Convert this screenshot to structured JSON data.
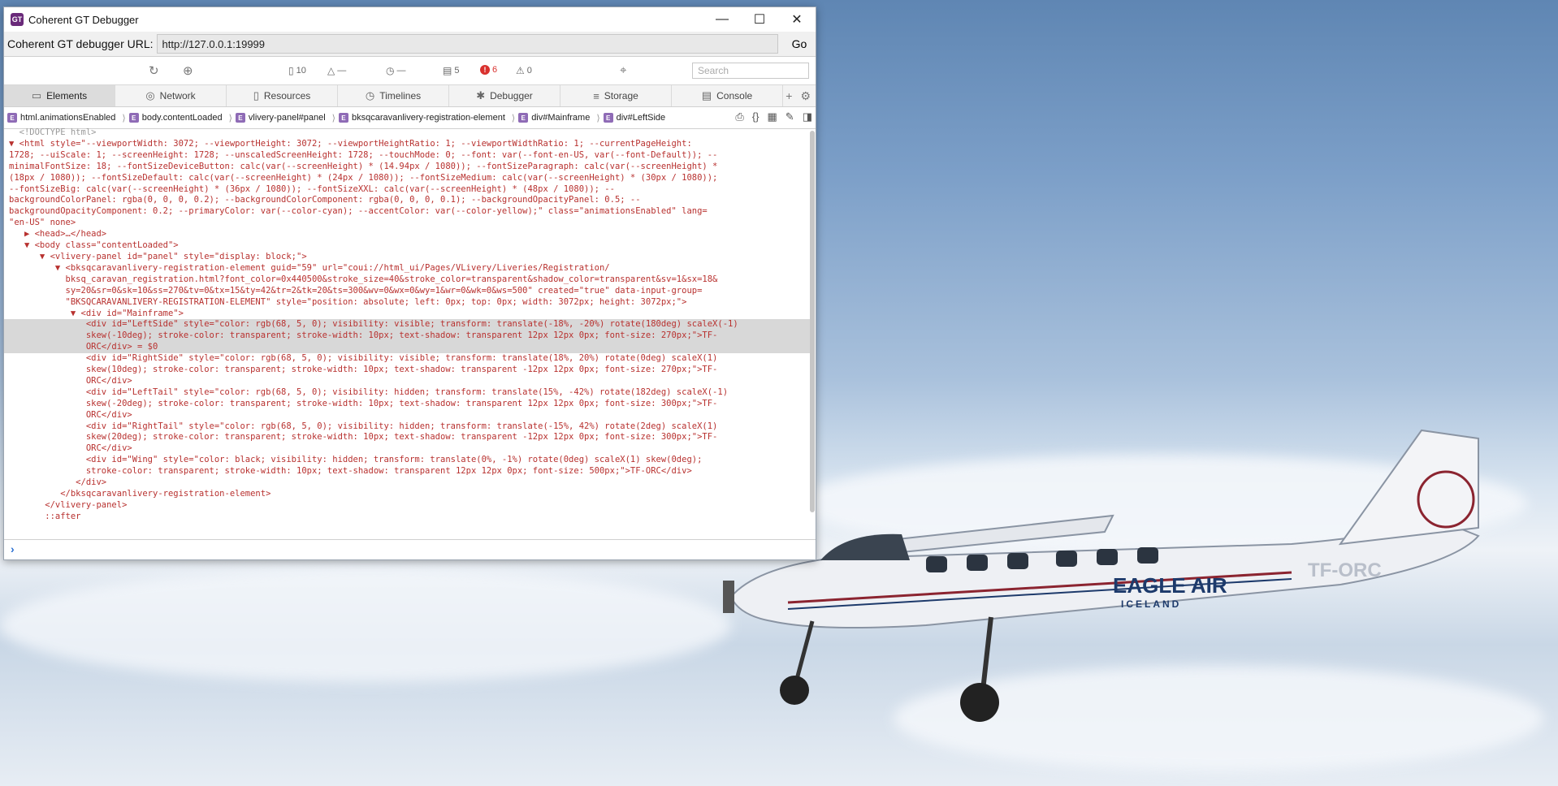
{
  "window": {
    "title": "Coherent GT Debugger",
    "icon_text": "GT"
  },
  "urlbar": {
    "label": "Coherent GT debugger URL:",
    "url": "http://127.0.0.1:19999",
    "go": "Go"
  },
  "toolbar": {
    "files": "10",
    "warnings_a": "—",
    "warnings_b": "—",
    "messages": "5",
    "errors": "6",
    "alerts": "0",
    "search_placeholder": "Search"
  },
  "tabs": [
    "Elements",
    "Network",
    "Resources",
    "Timelines",
    "Debugger",
    "Storage",
    "Console"
  ],
  "breadcrumbs": [
    "html.animationsEnabled",
    "body.contentLoaded",
    "vlivery-panel#panel",
    "bksqcaravanlivery-registration-element",
    "div#Mainframe",
    "div#LeftSide"
  ],
  "dom_lines": [
    "  <!DOCTYPE html>",
    "▼ <html style=\"--viewportWidth: 3072; --viewportHeight: 3072; --viewportHeightRatio: 1; --viewportWidthRatio: 1; --currentPageHeight:",
    "1728; --uiScale: 1; --screenHeight: 1728; --unscaledScreenHeight: 1728; --touchMode: 0; --font: var(--font-en-US, var(--font-Default)); --",
    "minimalFontSize: 18; --fontSizeDeviceButton: calc(var(--screenHeight) * (14.94px / 1080)); --fontSizeParagraph: calc(var(--screenHeight) *",
    "(18px / 1080)); --fontSizeDefault: calc(var(--screenHeight) * (24px / 1080)); --fontSizeMedium: calc(var(--screenHeight) * (30px / 1080));",
    "--fontSizeBig: calc(var(--screenHeight) * (36px / 1080)); --fontSizeXXL: calc(var(--screenHeight) * (48px / 1080)); --",
    "backgroundColorPanel: rgba(0, 0, 0, 0.2); --backgroundColorComponent: rgba(0, 0, 0, 0.1); --backgroundOpacityPanel: 0.5; --",
    "backgroundOpacityComponent: 0.2; --primaryColor: var(--color-cyan); --accentColor: var(--color-yellow);\" class=\"animationsEnabled\" lang=",
    "\"en-US\" none>",
    "   ▶ <head>…</head>",
    "   ▼ <body class=\"contentLoaded\">",
    "      ▼ <vlivery-panel id=\"panel\" style=\"display: block;\">",
    "         ▼ <bksqcaravanlivery-registration-element guid=\"59\" url=\"coui://html_ui/Pages/VLivery/Liveries/Registration/",
    "           bksq_caravan_registration.html?font_color=0x440500&stroke_size=40&stroke_color=transparent&shadow_color=transparent&sv=1&sx=18&",
    "           sy=20&sr=0&sk=10&ss=270&tv=0&tx=15&ty=42&tr=2&tk=20&ts=300&wv=0&wx=0&wy=1&wr=0&wk=0&ws=500\" created=\"true\" data-input-group=",
    "           \"BKSQCARAVANLIVERY-REGISTRATION-ELEMENT\" style=\"position: absolute; left: 0px; top: 0px; width: 3072px; height: 3072px;\">",
    "            ▼ <div id=\"Mainframe\">",
    "               <div id=\"LeftSide\" style=\"color: rgb(68, 5, 0); visibility: visible; transform: translate(-18%, -20%) rotate(180deg) scaleX(-1)",
    "               skew(-10deg); stroke-color: transparent; stroke-width: 10px; text-shadow: transparent 12px 12px 0px; font-size: 270px;\">TF-",
    "               ORC</div> = $0",
    "               <div id=\"RightSide\" style=\"color: rgb(68, 5, 0); visibility: visible; transform: translate(18%, 20%) rotate(0deg) scaleX(1)",
    "               skew(10deg); stroke-color: transparent; stroke-width: 10px; text-shadow: transparent -12px 12px 0px; font-size: 270px;\">TF-",
    "               ORC</div>",
    "               <div id=\"LeftTail\" style=\"color: rgb(68, 5, 0); visibility: hidden; transform: translate(15%, -42%) rotate(182deg) scaleX(-1)",
    "               skew(-20deg); stroke-color: transparent; stroke-width: 10px; text-shadow: transparent 12px 12px 0px; font-size: 300px;\">TF-",
    "               ORC</div>",
    "               <div id=\"RightTail\" style=\"color: rgb(68, 5, 0); visibility: hidden; transform: translate(-15%, 42%) rotate(2deg) scaleX(1)",
    "               skew(20deg); stroke-color: transparent; stroke-width: 10px; text-shadow: transparent -12px 12px 0px; font-size: 300px;\">TF-",
    "               ORC</div>",
    "               <div id=\"Wing\" style=\"color: black; visibility: hidden; transform: translate(0%, -1%) rotate(0deg) scaleX(1) skew(0deg);",
    "               stroke-color: transparent; stroke-width: 10px; text-shadow: transparent 12px 12px 0px; font-size: 500px;\">TF-ORC</div>",
    "             </div>",
    "          </bksqcaravanlivery-registration-element>",
    "       </vlivery-panel>",
    "       ::after"
  ],
  "selected_line_start": 17,
  "selected_line_end": 19,
  "plane": {
    "brand": "EAGLE AIR",
    "subbrand": "ICELAND",
    "registration": "TF-ORC"
  },
  "colors": {
    "dom_text": "#b8312f",
    "selection": "#d8d8d8",
    "error": "#d9312e",
    "accent_icon": "#6a2a7a"
  }
}
